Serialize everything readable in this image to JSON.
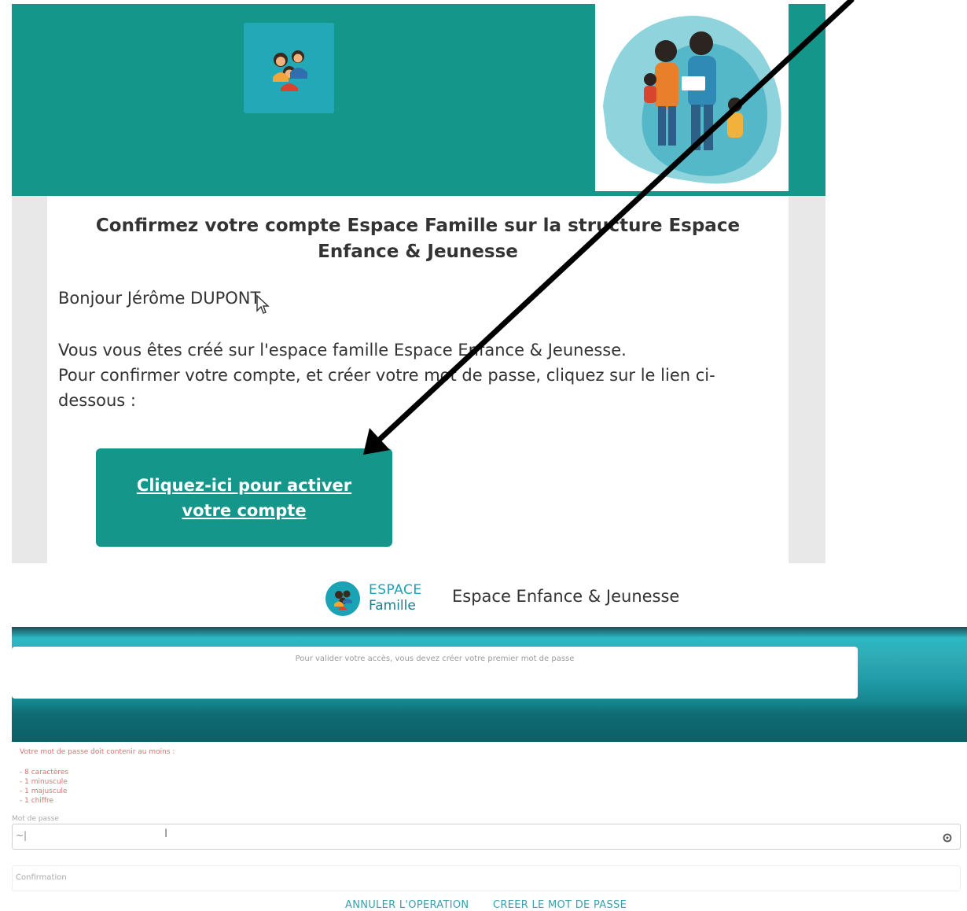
{
  "email": {
    "title": "Confirmez votre compte Espace Famille sur la structure Espace Enfance & Jeunesse",
    "greeting": "Bonjour Jérôme DUPONT",
    "paragraph_line1": "Vous vous êtes créé sur l'espace famille Espace Enfance & Jeunesse.",
    "paragraph_line2": "Pour confirmer votre compte, et créer votre mot de passe, cliquez sur le lien ci-dessous :",
    "activate_link_line1": "Cliquez-ici pour activer",
    "activate_link_line2": "votre compte"
  },
  "app": {
    "brand_line1": "ESPACE",
    "brand_line2": "Famille",
    "structure_name": "Espace Enfance & Jeunesse",
    "notice": "Pour valider votre accès, vous devez créer votre premier mot de passe",
    "requirements_title": "Votre mot de passe doit contenir au moins :",
    "requirements": [
      "- 8 caractères",
      "- 1 minuscule",
      "- 1 majuscule",
      "- 1 chiffre"
    ],
    "password_label": "Mot de passe",
    "password_value": "~|",
    "confirmation_placeholder": "Confirmation",
    "cancel_label": "ANNULER L'OPERATION",
    "create_label": "CREER LE MOT DE PASSE"
  },
  "colors": {
    "email_teal": "#14968a",
    "logo_blue": "#23a8b8",
    "link_blue": "#3a9fad",
    "requirement_red": "#e07070"
  },
  "icons": [
    "family-logo-icon",
    "cursor-icon",
    "eye-icon",
    "text-cursor-icon",
    "annotation-arrow"
  ]
}
